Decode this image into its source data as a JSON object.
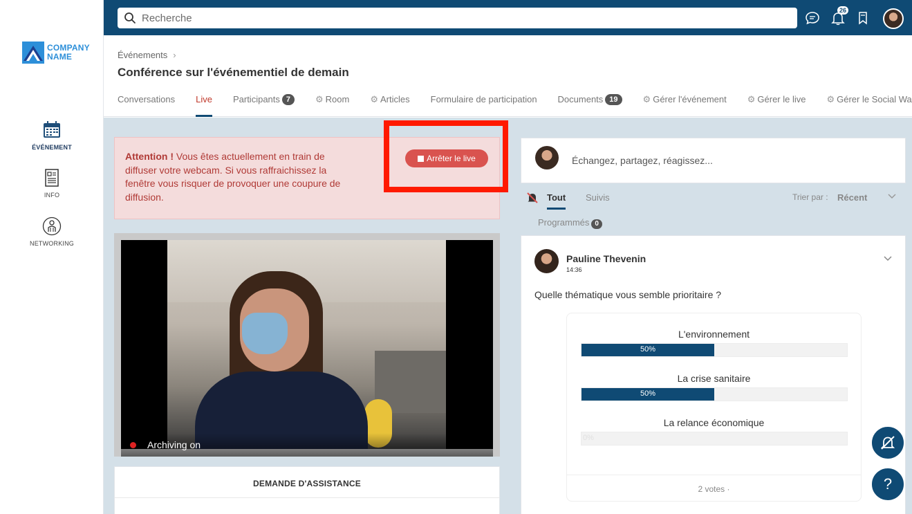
{
  "brand": {
    "line1": "COMPANY",
    "line2": "NAME"
  },
  "sidebar": {
    "items": [
      {
        "label": "ÉVÉNEMENT",
        "icon": "calendar-icon"
      },
      {
        "label": "INFO",
        "icon": "document-icon"
      },
      {
        "label": "NETWORKING",
        "icon": "person-icon"
      }
    ]
  },
  "topbar": {
    "search_placeholder": "Recherche",
    "notification_count": "26"
  },
  "header": {
    "breadcrumb": "Événements",
    "title": "Conférence sur l'événementiel de demain",
    "tabs": [
      {
        "label": "Conversations"
      },
      {
        "label": "Live"
      },
      {
        "label": "Participants",
        "count": "7"
      },
      {
        "label": "Room"
      },
      {
        "label": "Articles"
      },
      {
        "label": "Formulaire de participation"
      },
      {
        "label": "Documents",
        "count": "19"
      },
      {
        "label": "Gérer l'événement"
      },
      {
        "label": "Gérer le live"
      },
      {
        "label": "Gérer le Social Wall"
      }
    ]
  },
  "alert": {
    "strong": "Attention !",
    "text": " Vous êtes actuellement en train de diffuser votre webcam. Si vous raffraichissez la fenêtre vous risquer de provoquer une coupure de diffusion.",
    "stop_label": "Arrêter le live"
  },
  "video": {
    "status": "Archiving on"
  },
  "assist": {
    "title": "DEMANDE D'ASSISTANCE"
  },
  "composer": {
    "placeholder": "Échangez, partagez, réagissez..."
  },
  "feed": {
    "tab_all": "Tout",
    "tab_followed": "Suivis",
    "sort_label": "Trier par :",
    "sort_value": "Récent",
    "scheduled_label": "Programmés",
    "scheduled_count": "0"
  },
  "post": {
    "author": "Pauline Thevenin",
    "time": "14:36",
    "question": "Quelle thématique vous semble prioritaire ?",
    "poll": {
      "options": [
        {
          "label": "L'environnement",
          "percent": 50,
          "percent_label": "50%"
        },
        {
          "label": "La crise sanitaire",
          "percent": 50,
          "percent_label": "50%"
        },
        {
          "label": "La relance économique",
          "percent": 0,
          "percent_label": "0%"
        }
      ],
      "votes": "2 votes ·"
    }
  },
  "floating": {
    "help_label": "?"
  },
  "colors": {
    "primary": "#0f4a74",
    "danger": "#d9534f",
    "highlight": "#ff1a00",
    "active_tab": "#c0392b"
  }
}
